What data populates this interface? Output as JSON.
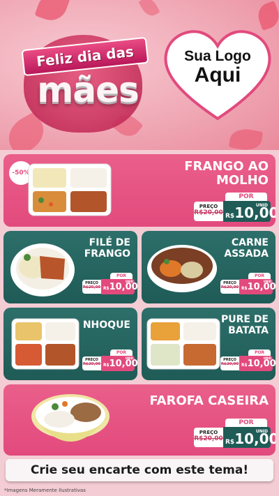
{
  "header": {
    "title_line1": "Feliz dia das",
    "title_line2": "mães",
    "logo_line1": "Sua Logo",
    "logo_line2": "Aqui"
  },
  "products": [
    {
      "name_line1": "FRANGO AO",
      "name_line2": "MOLHO",
      "discount": "-50%",
      "price_label": "PREÇO",
      "old_price": "R$20,00",
      "per_label": "POR",
      "currency": "R$",
      "price": "10,00",
      "unit": "UNID",
      "dish_icon": "tray-meal-icon"
    },
    {
      "name_line1": "FILÉ DE",
      "name_line2": "FRANGO",
      "price_label": "PREÇO",
      "old_price": "R$20,00",
      "per_label": "POR",
      "currency": "R$",
      "price": "10,00",
      "unit": "UNID",
      "dish_icon": "plate-chicken-icon"
    },
    {
      "name_line1": "CARNE",
      "name_line2": "ASSADA",
      "price_label": "PREÇO",
      "old_price": "R$20,00",
      "per_label": "POR",
      "currency": "R$",
      "price": "10,00",
      "unit": "UNID",
      "dish_icon": "bowl-beef-icon"
    },
    {
      "name_line1": "NHOQUE",
      "price_label": "PREÇO",
      "old_price": "R$20,00",
      "per_label": "POR",
      "currency": "R$",
      "price": "10,00",
      "unit": "UNID",
      "dish_icon": "tray-gnocchi-icon"
    },
    {
      "name_line1": "PURE DE",
      "name_line2": "BATATA",
      "price_label": "PREÇO",
      "old_price": "R$20,00",
      "per_label": "POR",
      "currency": "R$",
      "price": "10,00",
      "unit": "UNID",
      "dish_icon": "tray-puree-icon"
    },
    {
      "name_line1": "FAROFA CASEIRA",
      "price_label": "PREÇO",
      "old_price": "R$20,00",
      "per_label": "POR",
      "currency": "R$",
      "price": "10,00",
      "unit": "UNID",
      "dish_icon": "bowl-farofa-icon"
    }
  ],
  "cta": "Crie seu encarte com este tema!",
  "footnote": "*Imagens Meramente Ilustrativas",
  "colors": {
    "pink": "#e24a7d",
    "teal": "#1f5b57",
    "background": "#f4ccd4"
  }
}
